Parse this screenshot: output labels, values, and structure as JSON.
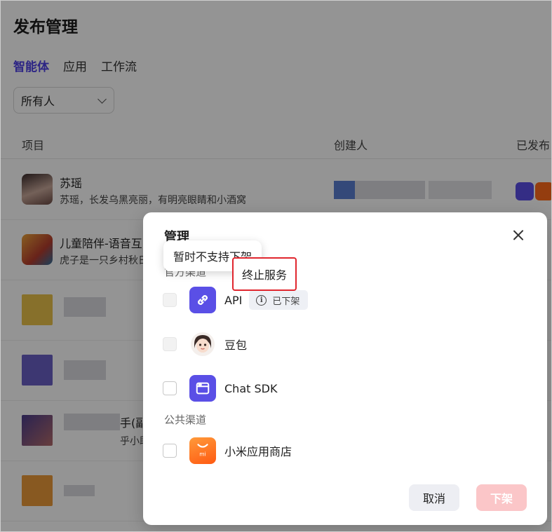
{
  "page": {
    "title": "发布管理",
    "tabs": [
      "智能体",
      "应用",
      "工作流"
    ],
    "filter_value": "所有人",
    "columns": {
      "project": "项目",
      "creator": "创建人",
      "published": "已发布"
    },
    "rows": [
      {
        "name": "苏瑶",
        "desc": "苏瑶，长发乌黑亮丽，有明亮眼睛和小酒窝"
      },
      {
        "name": "儿童陪伴-语音互",
        "desc": "虎子是一只乡村秋日"
      },
      {
        "name": "",
        "desc": ""
      },
      {
        "name": "",
        "desc": ""
      },
      {
        "name": "手(副",
        "desc": "乎小助"
      },
      {
        "name": "",
        "desc": ""
      }
    ]
  },
  "modal": {
    "title": "管理",
    "section_private": "官方渠道",
    "section_public": "公共渠道",
    "channels": [
      {
        "name": "API",
        "badge": "已下架",
        "icon": "link-icon",
        "color": "#5a4fe6"
      },
      {
        "name": "豆包",
        "icon": "doubao-avatar-icon"
      },
      {
        "name": "Chat SDK",
        "icon": "window-icon",
        "color": "#5a4fe6"
      }
    ],
    "public_channels": [
      {
        "name": "小米应用商店",
        "icon": "xiaomi-store-icon",
        "color": "#ff6a1a"
      }
    ],
    "tooltip_unsupported": "暂时不支持下架",
    "tooltip_terminate": "终止服务",
    "cancel_label": "取消",
    "remove_label": "下架"
  },
  "colors": {
    "accent": "#4e40e5",
    "danger_disabled": "#fbc6c8",
    "highlight_border": "#e0262e"
  }
}
